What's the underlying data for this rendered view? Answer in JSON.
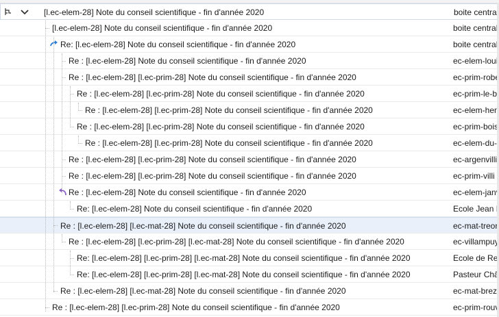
{
  "messages": [
    {
      "subject": "[l.ec-elem-28] Note du conseil scientifique - fin d'année 2020",
      "sender": "boite centrale"
    },
    {
      "subject": "[l.ec-elem-28] Note du conseil scientifique - fin d'année 2020",
      "sender": "boite centrale"
    },
    {
      "subject": "Re: [l.ec-elem-28] Note du conseil scientifique - fin d'année 2020",
      "sender": "boite centrale"
    },
    {
      "subject": "Re : [l.ec-elem-28] Note du conseil scientifique - fin d'année 2020",
      "sender": "ec-elem-loui"
    },
    {
      "subject": "Re : [l.ec-elem-28] [l.ec-prim-28] Note du conseil scientifique - fin d'année 2020",
      "sender": "ec-prim-robe"
    },
    {
      "subject": "Re : [l.ec-elem-28] [l.ec-prim-28] Note du conseil scientifique - fin d'année 2020",
      "sender": "ec-prim-le-b"
    },
    {
      "subject": "Re : [l.ec-elem-28] [l.ec-prim-28] Note du conseil scientifique - fin d'année 2020",
      "sender": "ec-elem-hen"
    },
    {
      "subject": "Re : [l.ec-elem-28] [l.ec-prim-28] Note du conseil scientifique - fin d'année 2020",
      "sender": "ec-prim-bois"
    },
    {
      "subject": "Re : [l.ec-elem-28] [l.ec-prim-28] Note du conseil scientifique - fin d'année 2020",
      "sender": "ec-elem-du-"
    },
    {
      "subject": "Re : [l.ec-elem-28] [l.ec-prim-28] Note du conseil scientifique - fin d'année 2020",
      "sender": "ec-argenvillie"
    },
    {
      "subject": "Re : [l.ec-elem-28] [l.ec-prim-28] Note du conseil scientifique - fin d'année 2020",
      "sender": "ec-prim-villi"
    },
    {
      "subject": "Re : [l.ec-elem-28] Note du conseil scientifique - fin d'année 2020",
      "sender": "ec-elem-janv"
    },
    {
      "subject": "Re: [l.ec-elem-28] Note du conseil scientifique - fin d'année 2020",
      "sender": "Ecole Jean M"
    },
    {
      "subject": "Re : [l.ec-elem-28] [l.ec-mat-28] Note du conseil scientifique - fin d'année 2020",
      "sender": "ec-mat-treor"
    },
    {
      "subject": "Re : [l.ec-elem-28] [l.ec-prim-28] [l.ec-mat-28] Note du conseil scientifique - fin d'année 2020",
      "sender": "ec-villampuy"
    },
    {
      "subject": "Re: [l.ec-elem-28] [l.ec-prim-28] [l.ec-mat-28] Note du conseil scientifique - fin d'année 2020",
      "sender": "Ecole de Rec"
    },
    {
      "subject": "Re: [l.ec-elem-28] [l.ec-prim-28] [l.ec-mat-28] Note du conseil scientifique - fin d'année 2020",
      "sender": "Pasteur Chât"
    },
    {
      "subject": "Re : [l.ec-elem-28] [l.ec-mat-28] Note du conseil scientifique - fin d'année 2020",
      "sender": "ec-mat-brez"
    },
    {
      "subject": "Re : [l.ec-elem-28] [l.ec-prim-28] Note du conseil scientifique - fin d'année 2020",
      "sender": "ec-prim-rouv"
    }
  ],
  "icons": {
    "thread_toggle": "thread-icon",
    "collapse": "chevron-down-icon",
    "forwarded": "forwarded-arrow-icon",
    "replied": "replied-arrow-icon"
  },
  "colors": {
    "selected_row": "#e9f0fa",
    "forwarded_arrow": "#2a7bd5",
    "replied_arrow": "#8a5fc7"
  }
}
